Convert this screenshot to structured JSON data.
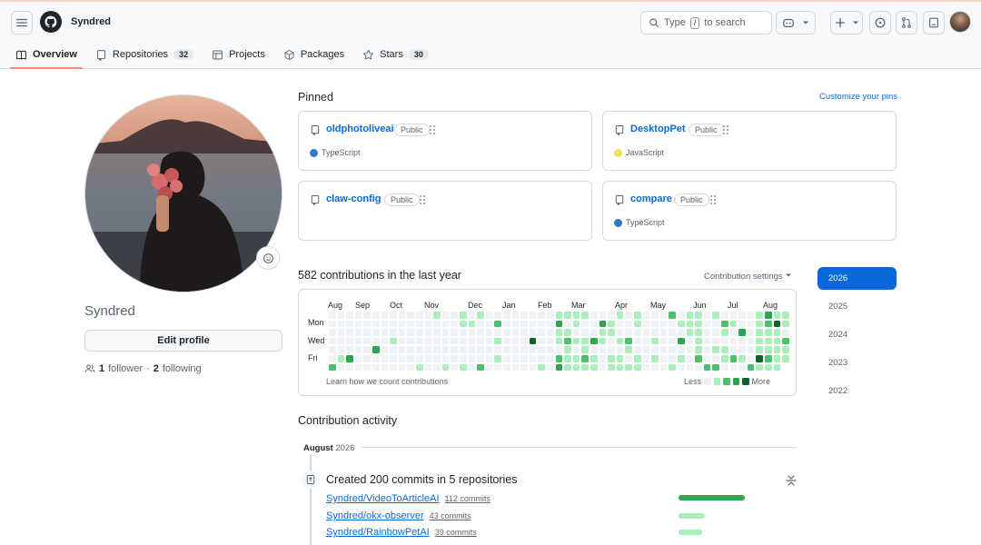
{
  "header": {
    "username": "Syndred",
    "search": {
      "prefix": "Type",
      "key": "/",
      "suffix": "to search"
    },
    "icons": [
      "menu-icon",
      "github-logo-icon",
      "search-icon",
      "copilot-icon",
      "plus-icon",
      "issue-icon",
      "pull-request-icon",
      "inbox-icon"
    ]
  },
  "tabs": [
    {
      "label": "Overview",
      "count": "",
      "icon": "book-icon",
      "active": true
    },
    {
      "label": "Repositories",
      "count": "32",
      "icon": "repo-icon"
    },
    {
      "label": "Projects",
      "count": "",
      "icon": "table-icon"
    },
    {
      "label": "Packages",
      "count": "",
      "icon": "package-icon"
    },
    {
      "label": "Stars",
      "count": "30",
      "icon": "star-icon"
    }
  ],
  "profile": {
    "name": "Syndred",
    "edit_label": "Edit profile",
    "followers": "1",
    "followers_label": "follower",
    "separator": "·",
    "following": "2",
    "following_label": "following"
  },
  "pinned": {
    "title": "Pinned",
    "customize": "Customize your pins",
    "repos": [
      {
        "name": "oldphotoliveai",
        "visibility": "Public",
        "language": "TypeScript",
        "lang_color": "#3178c6"
      },
      {
        "name": "DesktopPet",
        "visibility": "Public",
        "language": "JavaScript",
        "lang_color": "#f1e05a"
      },
      {
        "name": "claw-config",
        "visibility": "Public",
        "language": "",
        "lang_color": ""
      },
      {
        "name": "compare",
        "visibility": "Public",
        "language": "TypeScript",
        "lang_color": "#3178c6"
      }
    ]
  },
  "contributions": {
    "title": "582 contributions in the last year",
    "settings": "Contribution settings",
    "months": [
      "Aug",
      "Sep",
      "Oct",
      "Nov",
      "Dec",
      "Jan",
      "Feb",
      "Mar",
      "Apr",
      "May",
      "Jun",
      "Jul",
      "Aug"
    ],
    "days": [
      "Mon",
      "Wed",
      "Fri"
    ],
    "learn": "Learn how we count contributions",
    "legend_less": "Less",
    "legend_more": "More",
    "colors": [
      "#eff2f5",
      "#aceebb",
      "#4ac26b",
      "#2da44e",
      "#116329"
    ]
  },
  "years": [
    "2026",
    "2025",
    "2024",
    "2023",
    "2022"
  ],
  "activity": {
    "title": "Contribution activity",
    "month_label": "August",
    "month_year": "2026",
    "summary": "Created 200 commits in 5 repositories",
    "repos": [
      {
        "name": "Syndred/VideoToArticleAI",
        "commits": "112 commits",
        "share": 0.56,
        "color": "#2da44e"
      },
      {
        "name": "Syndred/okx-observer",
        "commits": "43 commits",
        "share": 0.22,
        "color": "#aceebb"
      },
      {
        "name": "Syndred/RainbowPetAI",
        "commits": "39 commits",
        "share": 0.2,
        "color": "#aceebb"
      }
    ]
  }
}
